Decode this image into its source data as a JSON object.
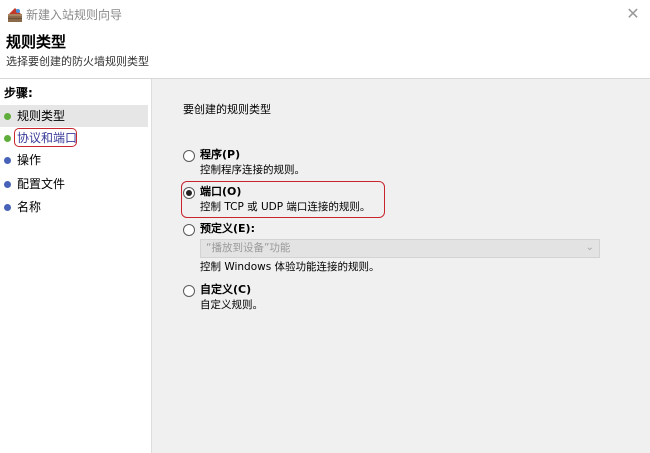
{
  "window": {
    "title": "新建入站规则向导",
    "close_glyph": "✕"
  },
  "header": {
    "title": "规则类型",
    "subtitle": "选择要创建的防火墙规则类型"
  },
  "sidebar": {
    "steps_label": "步骤:",
    "items": [
      {
        "label": "规则类型",
        "bullet_color": "#5fae3c"
      },
      {
        "label": "协议和端口",
        "bullet_color": "#5fae3c"
      },
      {
        "label": "操作",
        "bullet_color": "#4762b8"
      },
      {
        "label": "配置文件",
        "bullet_color": "#4762b8"
      },
      {
        "label": "名称",
        "bullet_color": "#4762b8"
      }
    ]
  },
  "main": {
    "prompt": "要创建的规则类型",
    "options": [
      {
        "label": "程序(P)",
        "description": "控制程序连接的规则。",
        "checked": false
      },
      {
        "label": "端口(O)",
        "description": "控制 TCP 或 UDP 端口连接的规则。",
        "checked": true
      },
      {
        "label": "预定义(E):",
        "description": "控制 Windows 体验功能连接的规则。",
        "checked": false
      },
      {
        "label": "自定义(C)",
        "description": "自定义规则。",
        "checked": false
      }
    ],
    "predefined_combo": {
      "value": "“播放到设备”功能",
      "arrow": "⌄"
    }
  },
  "colors": {
    "highlight_ring": "#c8242c",
    "content_background": "#f0f0f0"
  },
  "icons": {
    "app": "firewall-wizard-icon",
    "close": "close-icon"
  }
}
